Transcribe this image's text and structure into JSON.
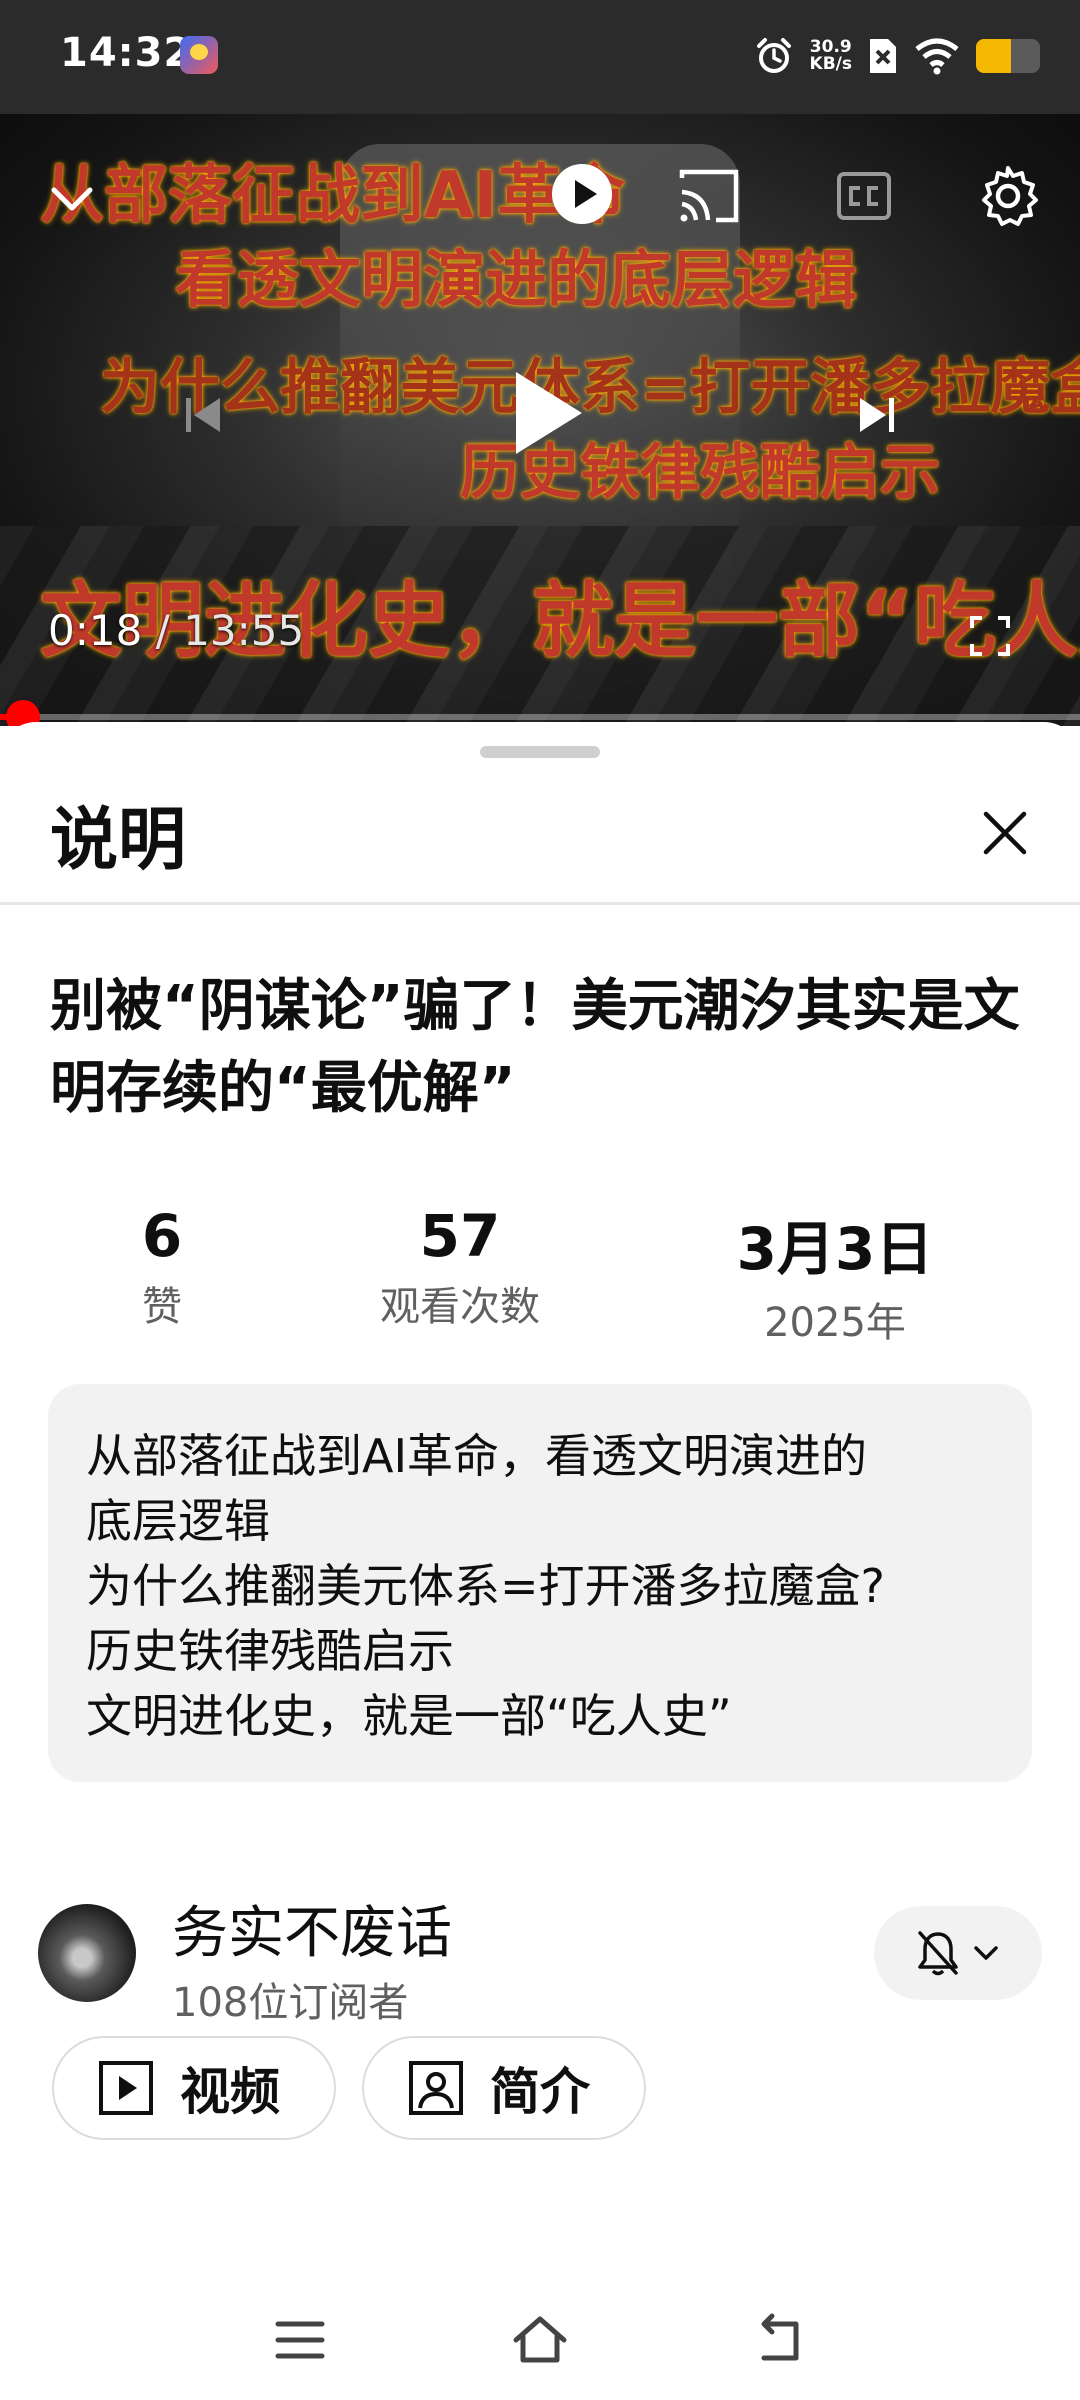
{
  "status_bar": {
    "time": "14:32",
    "net_speed_value": "30.9",
    "net_speed_unit": "KB/s",
    "battery_level": 0.55,
    "icons": [
      "app-notification-icon",
      "alarm-icon",
      "no-sim-icon",
      "wifi-icon",
      "battery-icon"
    ]
  },
  "video": {
    "overlay_lines": [
      "从部落征战到AI革命",
      "看透文明演进的底层逻辑",
      "为什么推翻美元体系=打开潘多拉魔盒?",
      "历史铁律残酷启示",
      "文明进化史，就是一部“吃人史”"
    ],
    "time_current": "0:18",
    "time_separator": " / ",
    "time_total": "13:55",
    "progress": 0.02,
    "controls": [
      "collapse-icon",
      "autoplay-icon",
      "cast-icon",
      "captions-icon",
      "settings-icon",
      "previous-icon",
      "play-icon",
      "next-icon",
      "fullscreen-icon"
    ]
  },
  "sheet": {
    "title": "说明",
    "video_title": "别被“阴谋论”骗了！美元潮汐其实是文明存续的“最优解”",
    "stats": [
      {
        "value": "6",
        "label": "赞"
      },
      {
        "value": "57",
        "label": "观看次数"
      },
      {
        "value": "3月3日",
        "label": "2025年"
      }
    ],
    "description": [
      "从部落征战到AI革命，看透文明演进的",
      "底层逻辑",
      "为什么推翻美元体系=打开潘多拉魔盒?",
      "历史铁律残酷启示",
      "文明进化史，就是一部“吃人史”"
    ],
    "channel": {
      "name": "务实不废话",
      "subscribers": "108位订阅者"
    },
    "buttons": {
      "videos": "视频",
      "about": "简介"
    }
  },
  "colors": {
    "progress": "#ff0000",
    "battery": "#f5b800",
    "text_primary": "#0f0f0f",
    "text_secondary": "#606060"
  }
}
